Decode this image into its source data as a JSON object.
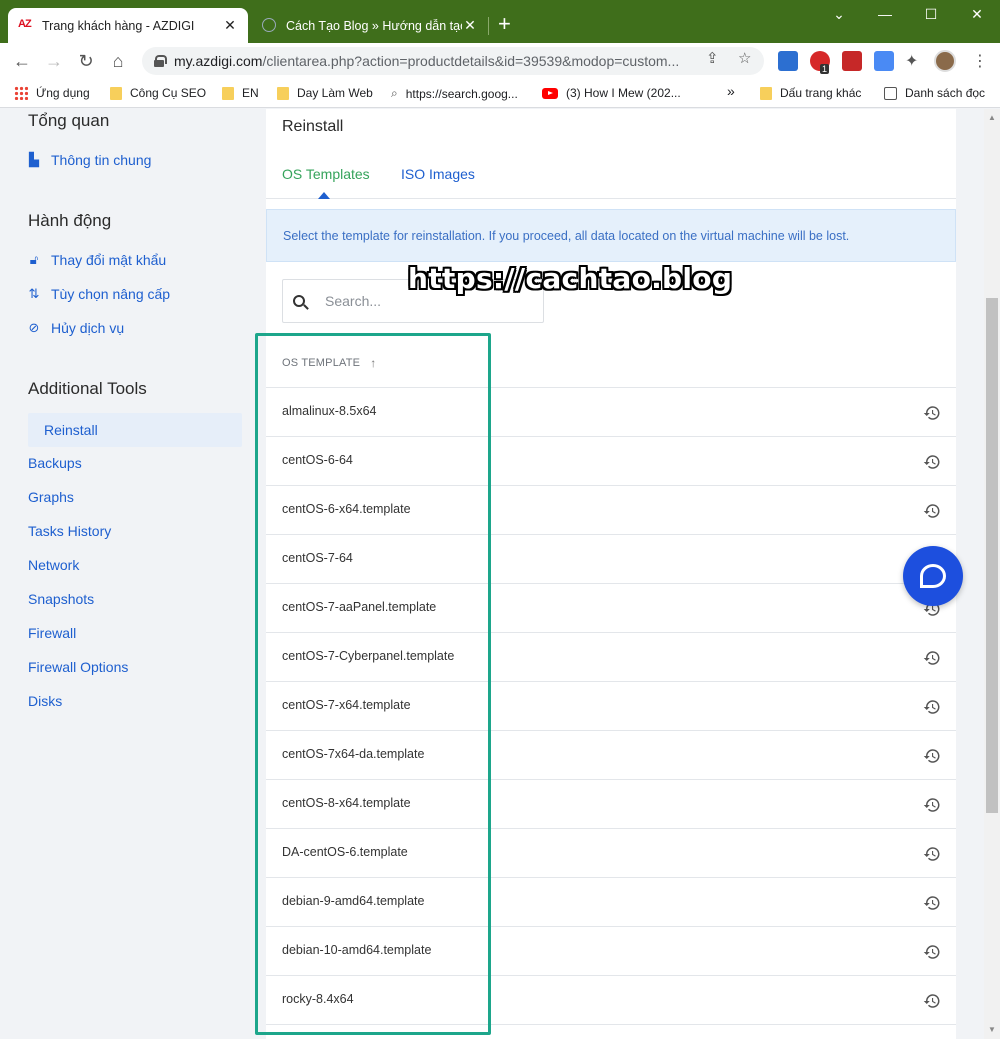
{
  "browser": {
    "tabs": [
      {
        "title": "Trang khách hàng - AZDIGI",
        "active": true,
        "favicon": "azdigi-logo"
      },
      {
        "title": "Cách Tạo Blog » Hướng dẫn tạo Blog",
        "active": false,
        "favicon": "globe-icon"
      }
    ],
    "favicon_text_az": "AZ",
    "address": {
      "host": "my.azdigi.com",
      "path": "/clientarea.php?action=productdetails&id=39539&modop=custom..."
    },
    "extension_badge": "1",
    "bookmarks": [
      {
        "label": "Ứng dụng",
        "icon": "apps-grid-icon"
      },
      {
        "label": "Công Cụ SEO",
        "icon": "folder-icon"
      },
      {
        "label": "EN",
        "icon": "folder-icon"
      },
      {
        "label": "Day Làm Web",
        "icon": "folder-icon"
      },
      {
        "label": "https://search.goog...",
        "icon": "search-icon"
      },
      {
        "label": "(3) How I Mew (202...",
        "icon": "youtube-icon"
      },
      {
        "label": "»",
        "icon": ""
      },
      {
        "label": "Dấu trang khác",
        "icon": "folder-icon"
      },
      {
        "label": "Danh sách đọc",
        "icon": "reading-list-icon"
      }
    ]
  },
  "sidebar": {
    "overview_heading": "Tổng quan",
    "overview_items": [
      {
        "label": "Thông tin chung",
        "icon": "dashboard-icon"
      }
    ],
    "actions_heading": "Hành động",
    "action_items": [
      {
        "label": "Thay đổi mật khẩu",
        "icon": "lock-icon"
      },
      {
        "label": "Tùy chọn nâng cấp",
        "icon": "sort-arrows-icon"
      },
      {
        "label": "Hủy dịch vụ",
        "icon": "ban-icon"
      }
    ],
    "tools_heading": "Additional Tools",
    "tools": [
      "Reinstall",
      "Backups",
      "Graphs",
      "Tasks History",
      "Network",
      "Snapshots",
      "Firewall",
      "Firewall Options",
      "Disks"
    ],
    "active_tool": "Reinstall"
  },
  "main": {
    "title": "Reinstall",
    "tabs": [
      "OS Templates",
      "ISO Images"
    ],
    "active_tab": "OS Templates",
    "info": "Select the template for reinstallation. If you proceed, all data located on the virtual machine will be lost.",
    "search_placeholder": "Search...",
    "column_header": "OS TEMPLATE",
    "sort_indicator": "↑",
    "templates": [
      "almalinux-8.5x64",
      "centOS-6-64",
      "centOS-6-x64.template",
      "centOS-7-64",
      "centOS-7-aaPanel.template",
      "centOS-7-Cyberpanel.template",
      "centOS-7-x64.template",
      "centOS-7x64-da.template",
      "centOS-8-x64.template",
      "DA-centOS-6.template",
      "debian-9-amd64.template",
      "debian-10-amd64.template",
      "rocky-8.4x64"
    ]
  },
  "watermark": "https://cachtao.blog",
  "colors": {
    "tabbar": "#3f6e1b",
    "link": "#1e5fcf",
    "active_tab": "#35a35b",
    "highlight_border": "#1da68b",
    "chat": "#1d4fde"
  }
}
